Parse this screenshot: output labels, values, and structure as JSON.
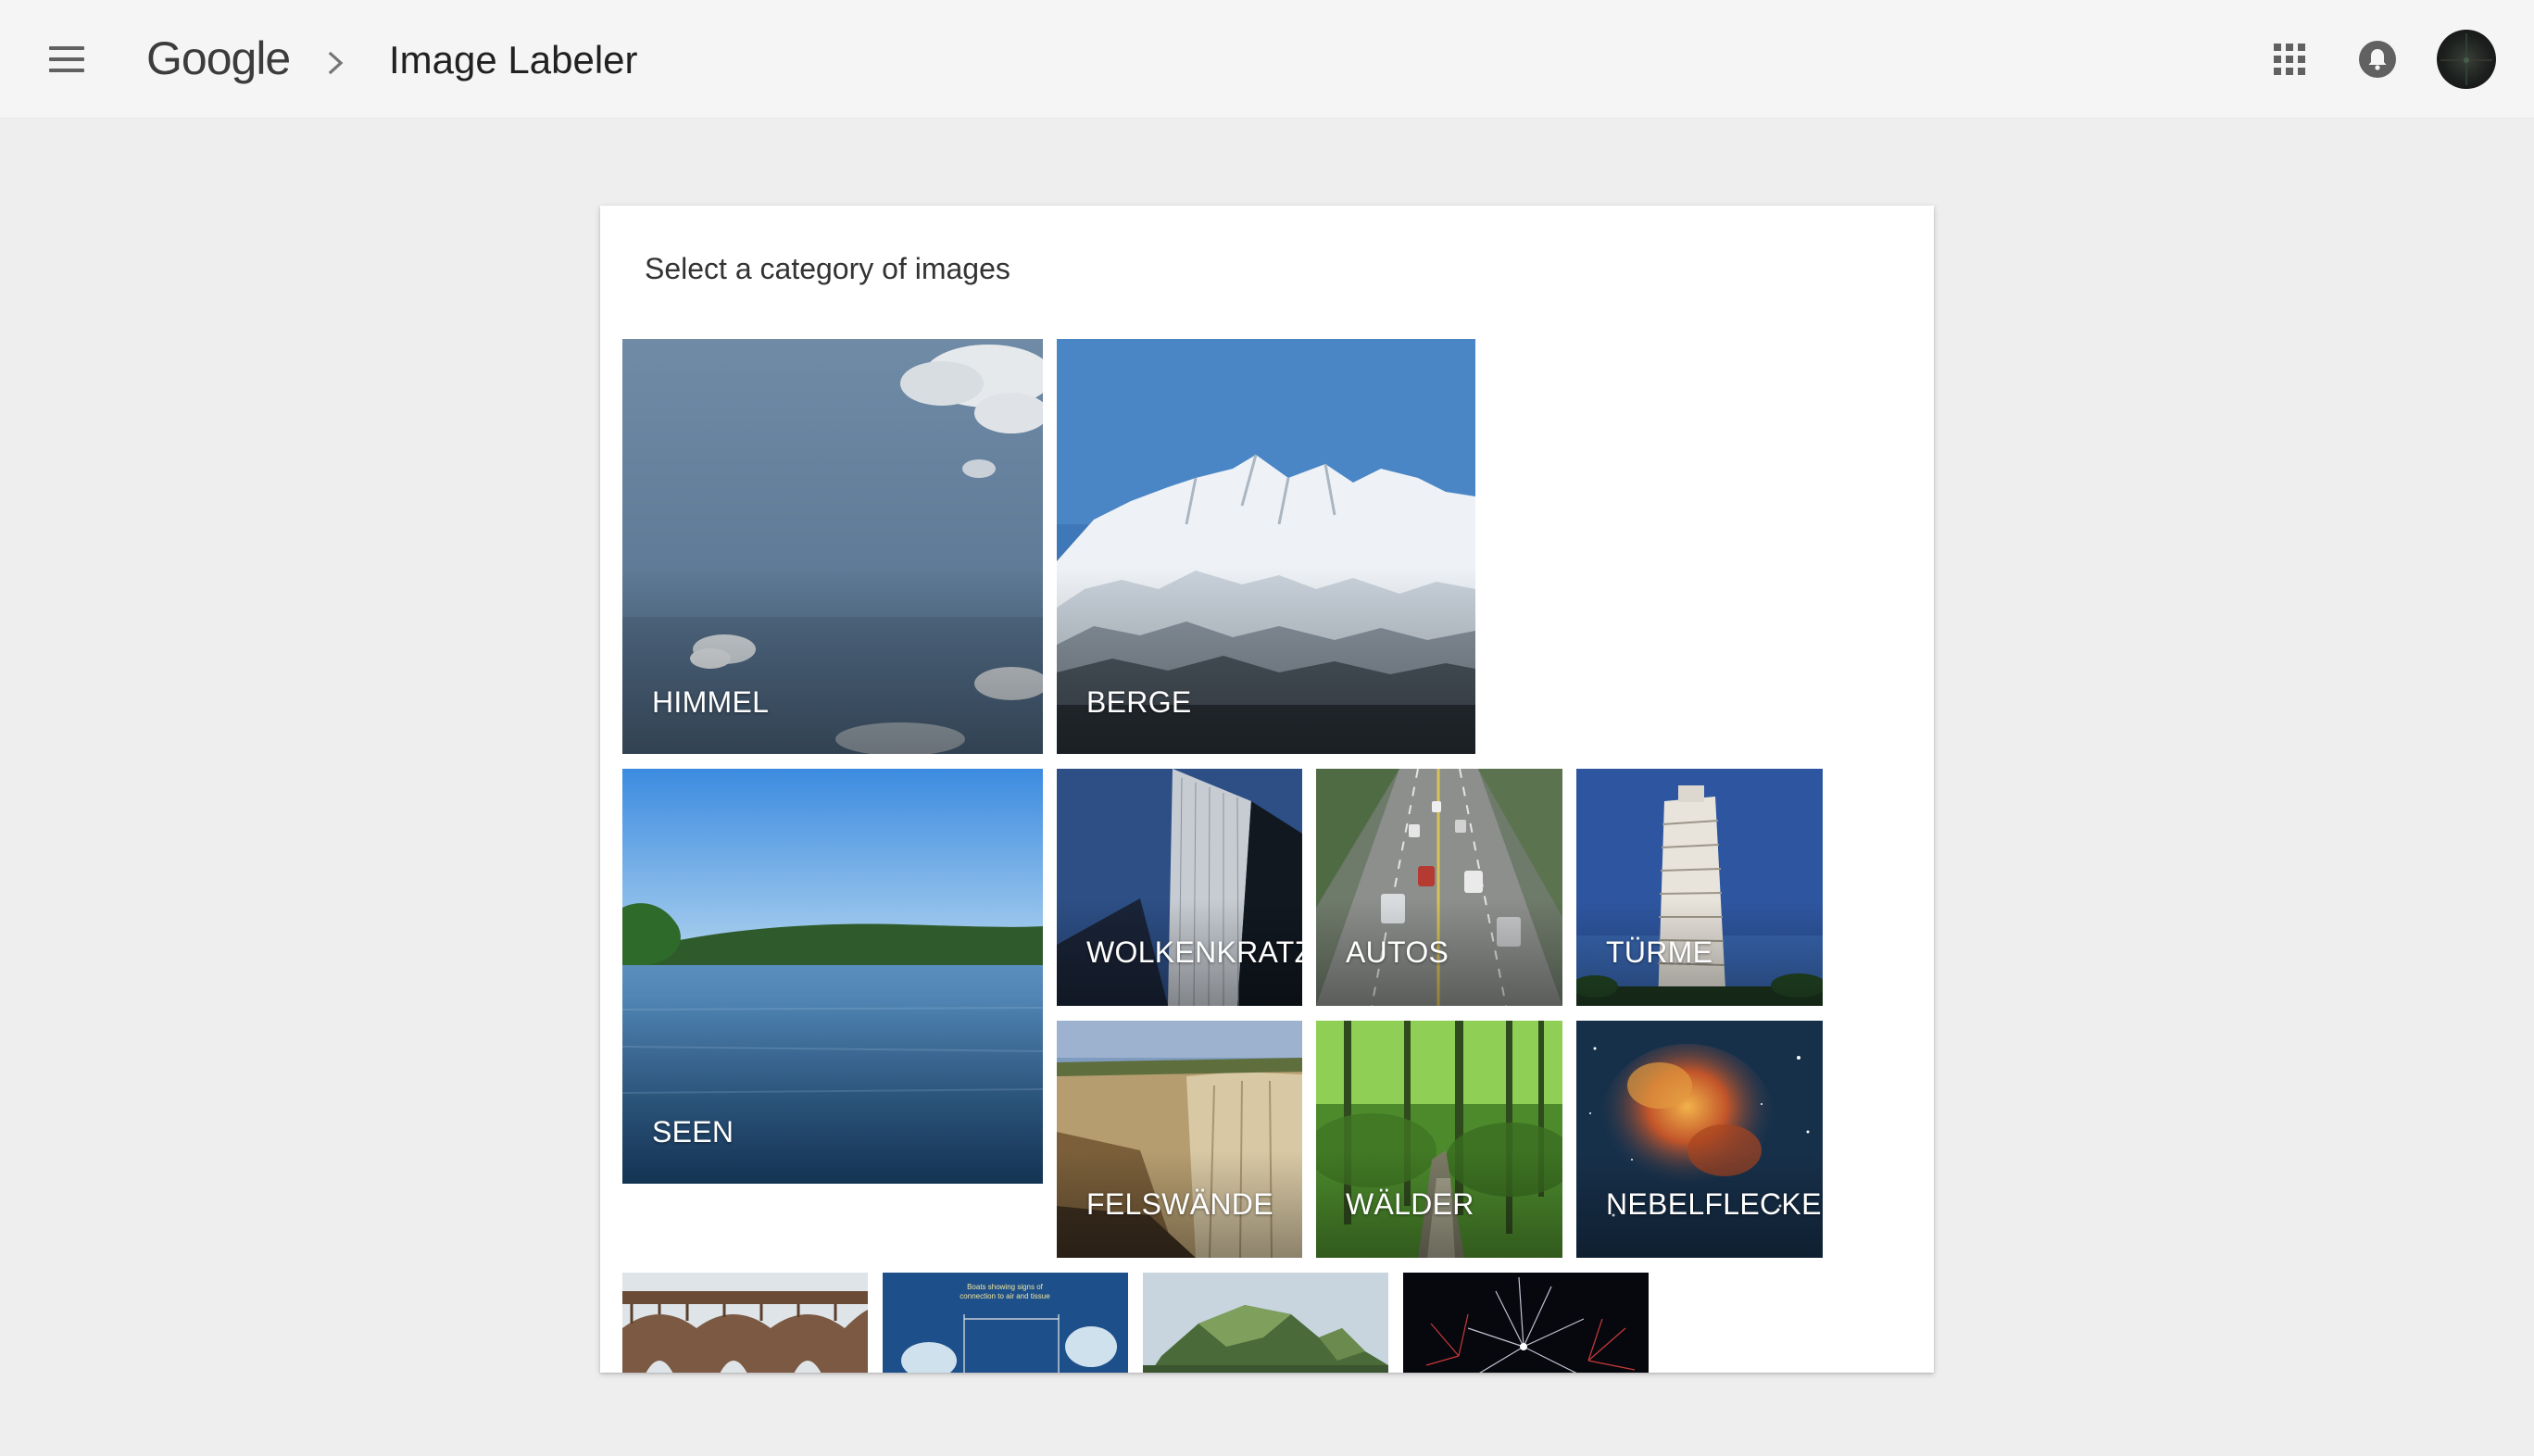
{
  "header": {
    "logo_text": "Google",
    "app_title": "Image Labeler",
    "icons": [
      "menu-icon",
      "chevron-right-icon",
      "apps-grid-icon",
      "notifications-icon",
      "avatar"
    ]
  },
  "main": {
    "heading": "Select a category of images",
    "categories": [
      {
        "label": "HIMMEL"
      },
      {
        "label": "BERGE"
      },
      {
        "label": "SEEN"
      },
      {
        "label": "WOLKENKRATZER"
      },
      {
        "label": "AUTOS"
      },
      {
        "label": "TÜRME"
      },
      {
        "label": "FELSWÄNDE"
      },
      {
        "label": "WÄLDER"
      },
      {
        "label": "NEBELFLECKE"
      }
    ],
    "partial_tiles": [
      {
        "thumb_text_line1": "Boats showing signs of",
        "thumb_text_line2": "connection to air and tissue"
      }
    ]
  },
  "colors": {
    "appbar_bg": "#f5f5f5",
    "page_bg": "#eeeeee",
    "card_bg": "#ffffff",
    "icon_gray": "#616161",
    "title_text": "#212121"
  }
}
